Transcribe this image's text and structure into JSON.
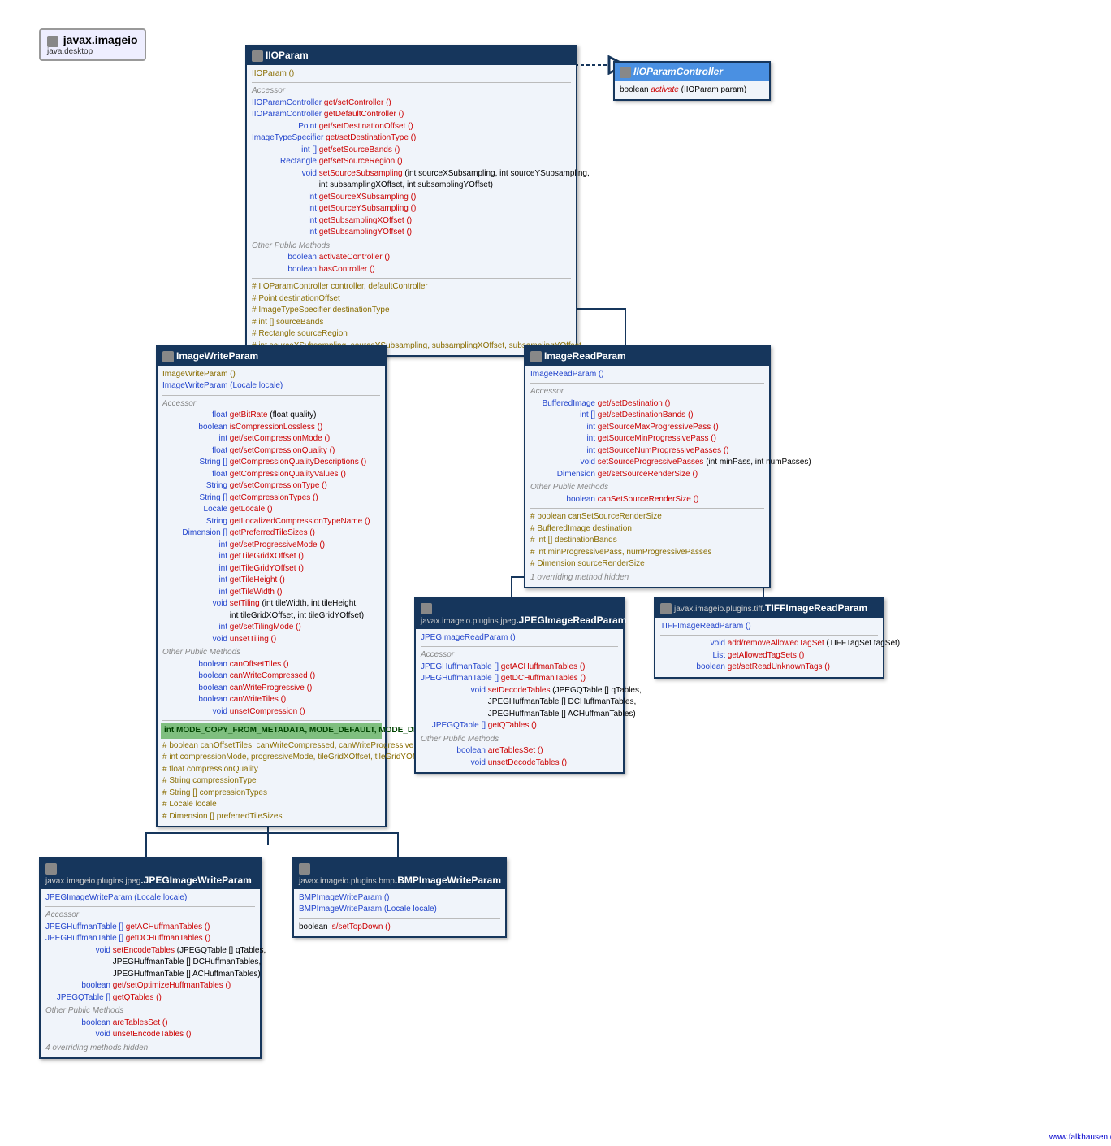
{
  "package": {
    "name": "javax.imageio",
    "module": "java.desktop"
  },
  "footer": "www.falkhausen.de",
  "boxes": {
    "IIOParam": {
      "title": "IIOParam",
      "ctor": "IIOParam ()",
      "accessor_label": "Accessor",
      "accessors": [
        {
          "type": "IIOParamController",
          "name": "get/setController ()"
        },
        {
          "type": "IIOParamController",
          "name": "getDefaultController ()"
        },
        {
          "type": "Point",
          "name": "get/setDestinationOffset ()"
        },
        {
          "type": "ImageTypeSpecifier",
          "name": "get/setDestinationType ()"
        },
        {
          "type": "int []",
          "name": "get/setSourceBands ()"
        },
        {
          "type": "Rectangle",
          "name": "get/setSourceRegion ()"
        },
        {
          "type": "void",
          "name": "setSourceSubsampling",
          "args": "(int sourceXSubsampling, int sourceYSubsampling,"
        },
        {
          "type": "",
          "name": "",
          "args": "int subsamplingXOffset, int subsamplingYOffset)"
        },
        {
          "type": "int",
          "name": "getSourceXSubsampling ()"
        },
        {
          "type": "int",
          "name": "getSourceYSubsampling ()"
        },
        {
          "type": "int",
          "name": "getSubsamplingXOffset ()"
        },
        {
          "type": "int",
          "name": "getSubsamplingYOffset ()"
        }
      ],
      "other_label": "Other Public Methods",
      "others": [
        {
          "type": "boolean",
          "name": "activateController ()"
        },
        {
          "type": "boolean",
          "name": "hasController ()"
        }
      ],
      "fields": [
        "# IIOParamController controller, defaultController",
        "# Point destinationOffset",
        "# ImageTypeSpecifier destinationType",
        "# int [] sourceBands",
        "# Rectangle sourceRegion",
        "# int sourceXSubsampling, sourceYSubsampling, subsamplingXOffset, subsamplingYOffset"
      ]
    },
    "IIOParamController": {
      "title": "IIOParamController",
      "method": {
        "ret": "boolean",
        "name": "activate",
        "args": "(IIOParam param)"
      }
    },
    "ImageWriteParam": {
      "title": "ImageWriteParam",
      "ctors": [
        "ImageWriteParam ()",
        "ImageWriteParam (Locale locale)"
      ],
      "accessor_label": "Accessor",
      "accessors": [
        {
          "type": "float",
          "name": "getBitRate",
          "args": "(float quality)"
        },
        {
          "type": "boolean",
          "name": "isCompressionLossless ()"
        },
        {
          "type": "int",
          "name": "get/setCompressionMode ()"
        },
        {
          "type": "float",
          "name": "get/setCompressionQuality ()"
        },
        {
          "type": "String []",
          "name": "getCompressionQualityDescriptions ()"
        },
        {
          "type": "float",
          "name": "getCompressionQualityValues ()"
        },
        {
          "type": "String",
          "name": "get/setCompressionType ()"
        },
        {
          "type": "String []",
          "name": "getCompressionTypes ()"
        },
        {
          "type": "Locale",
          "name": "getLocale ()"
        },
        {
          "type": "String",
          "name": "getLocalizedCompressionTypeName ()"
        },
        {
          "type": "Dimension []",
          "name": "getPreferredTileSizes ()"
        },
        {
          "type": "int",
          "name": "get/setProgressiveMode ()"
        },
        {
          "type": "int",
          "name": "getTileGridXOffset ()"
        },
        {
          "type": "int",
          "name": "getTileGridYOffset ()"
        },
        {
          "type": "int",
          "name": "getTileHeight ()"
        },
        {
          "type": "int",
          "name": "getTileWidth ()"
        },
        {
          "type": "void",
          "name": "setTiling",
          "args": "(int tileWidth, int tileHeight,"
        },
        {
          "type": "",
          "name": "",
          "args": "int tileGridXOffset, int tileGridYOffset)"
        },
        {
          "type": "int",
          "name": "get/setTilingMode ()"
        },
        {
          "type": "void",
          "name": "unsetTiling ()"
        }
      ],
      "other_label": "Other Public Methods",
      "others": [
        {
          "type": "boolean",
          "name": "canOffsetTiles ()"
        },
        {
          "type": "boolean",
          "name": "canWriteCompressed ()"
        },
        {
          "type": "boolean",
          "name": "canWriteProgressive ()"
        },
        {
          "type": "boolean",
          "name": "canWriteTiles ()"
        },
        {
          "type": "void",
          "name": "unsetCompression ()"
        }
      ],
      "green": "int MODE_COPY_FROM_METADATA, MODE_DEFAULT, MODE_DISABLED, MODE_EXPLICIT",
      "fields": [
        "# boolean canOffsetTiles, canWriteCompressed, canWriteProgressive, canWriteTiles, tilingSet",
        "# int compressionMode, progressiveMode, tileGridXOffset, tileGridYOffset, tileHeight, tileWidth, tilingMode",
        "# float compressionQuality",
        "# String compressionType",
        "# String [] compressionTypes",
        "# Locale locale",
        "# Dimension [] preferredTileSizes"
      ]
    },
    "ImageReadParam": {
      "title": "ImageReadParam",
      "ctor": "ImageReadParam ()",
      "accessor_label": "Accessor",
      "accessors": [
        {
          "type": "BufferedImage",
          "name": "get/setDestination ()"
        },
        {
          "type": "int []",
          "name": "get/setDestinationBands ()"
        },
        {
          "type": "int",
          "name": "getSourceMaxProgressivePass ()"
        },
        {
          "type": "int",
          "name": "getSourceMinProgressivePass ()"
        },
        {
          "type": "int",
          "name": "getSourceNumProgressivePasses ()"
        },
        {
          "type": "void",
          "name": "setSourceProgressivePasses",
          "args": "(int minPass, int numPasses)"
        },
        {
          "type": "Dimension",
          "name": "get/setSourceRenderSize ()"
        }
      ],
      "other_label": "Other Public Methods",
      "others": [
        {
          "type": "boolean",
          "name": "canSetSourceRenderSize ()"
        }
      ],
      "fields": [
        "# boolean canSetSourceRenderSize",
        "# BufferedImage destination",
        "# int [] destinationBands",
        "# int minProgressivePass, numProgressivePasses",
        "# Dimension sourceRenderSize"
      ],
      "hidden": "1 overriding method hidden"
    },
    "JPEGImageReadParam": {
      "pkg": "javax.imageio.plugins.jpeg",
      "title": "JPEGImageReadParam",
      "ctor": "JPEGImageReadParam ()",
      "accessor_label": "Accessor",
      "accessors": [
        {
          "type": "JPEGHuffmanTable []",
          "name": "getACHuffmanTables ()"
        },
        {
          "type": "JPEGHuffmanTable []",
          "name": "getDCHuffmanTables ()"
        },
        {
          "type": "void",
          "name": "setDecodeTables",
          "args": "(JPEGQTable [] qTables,"
        },
        {
          "type": "",
          "name": "",
          "args": "JPEGHuffmanTable [] DCHuffmanTables,"
        },
        {
          "type": "",
          "name": "",
          "args": "JPEGHuffmanTable [] ACHuffmanTables)"
        },
        {
          "type": "JPEGQTable []",
          "name": "getQTables ()"
        }
      ],
      "other_label": "Other Public Methods",
      "others": [
        {
          "type": "boolean",
          "name": "areTablesSet ()"
        },
        {
          "type": "void",
          "name": "unsetDecodeTables ()"
        }
      ]
    },
    "TIFFImageReadParam": {
      "pkg": "javax.imageio.plugins.tiff",
      "title": "TIFFImageReadParam",
      "ctor": "TIFFImageReadParam ()",
      "accessors": [
        {
          "type": "void",
          "name": "add/removeAllowedTagSet",
          "args": "(TIFFTagSet tagSet)"
        },
        {
          "type": "List<TIFFTagSet>",
          "name": "getAllowedTagSets ()"
        },
        {
          "type": "boolean",
          "name": "get/setReadUnknownTags ()"
        }
      ]
    },
    "JPEGImageWriteParam": {
      "pkg": "javax.imageio.plugins.jpeg",
      "title": "JPEGImageWriteParam",
      "ctor": "JPEGImageWriteParam (Locale locale)",
      "accessor_label": "Accessor",
      "accessors": [
        {
          "type": "JPEGHuffmanTable []",
          "name": "getACHuffmanTables ()"
        },
        {
          "type": "JPEGHuffmanTable []",
          "name": "getDCHuffmanTables ()"
        },
        {
          "type": "void",
          "name": "setEncodeTables",
          "args": "(JPEGQTable [] qTables,"
        },
        {
          "type": "",
          "name": "",
          "args": "JPEGHuffmanTable [] DCHuffmanTables,"
        },
        {
          "type": "",
          "name": "",
          "args": "JPEGHuffmanTable [] ACHuffmanTables)"
        },
        {
          "type": "boolean",
          "name": "get/setOptimizeHuffmanTables ()"
        },
        {
          "type": "JPEGQTable []",
          "name": "getQTables ()"
        }
      ],
      "other_label": "Other Public Methods",
      "others": [
        {
          "type": "boolean",
          "name": "areTablesSet ()"
        },
        {
          "type": "void",
          "name": "unsetEncodeTables ()"
        }
      ],
      "hidden": "4 overriding methods hidden"
    },
    "BMPImageWriteParam": {
      "pkg": "javax.imageio.plugins.bmp",
      "title": "BMPImageWriteParam",
      "ctors": [
        "BMPImageWriteParam ()",
        "BMPImageWriteParam (Locale locale)"
      ],
      "accessor": {
        "type": "boolean",
        "name": "is/setTopDown ()"
      }
    }
  }
}
